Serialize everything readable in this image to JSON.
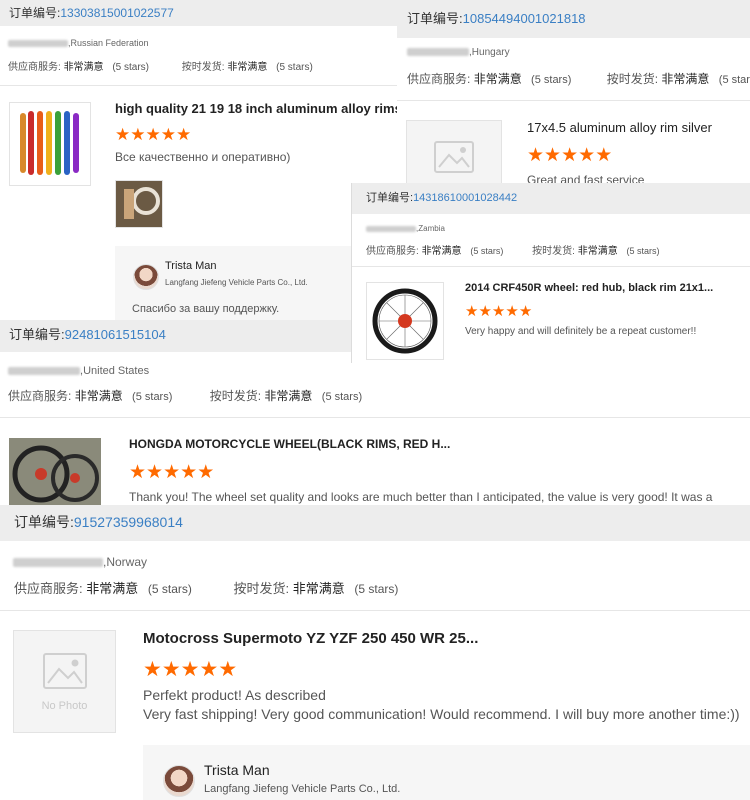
{
  "labels": {
    "order_no": "订单编号:",
    "supplier_service": "供应商服务:",
    "on_time_shipping": "按时发货:",
    "very_satisfied": "非常满意",
    "stars5": "(5 stars)",
    "no_photo": "No Photo"
  },
  "colors": {
    "accent_star": "#ff6a00",
    "order_link": "#3a7fc4",
    "header_bg": "#ededed"
  },
  "orders": [
    {
      "order_number": "13303815001022577",
      "country": "Russian Federation",
      "product_title": "high quality 21 19 18 inch aluminum alloy rims...",
      "rating": 5,
      "comment": "Все качественно и оперативно)",
      "reply": {
        "name": "Trista Man",
        "company": "Langfang Jiefeng Vehicle Parts Co., Ltd.",
        "text": "Спасибо за вашу поддержку."
      }
    },
    {
      "order_number": "10854494001021818",
      "country": "Hungary",
      "product_title": "17x4.5 aluminum alloy rim silver",
      "rating": 5,
      "comment": "Great and fast service"
    },
    {
      "order_number": "14318610001028442",
      "country": "Zambia",
      "product_title": "2014 CRF450R wheel: red hub, black rim 21x1...",
      "rating": 5,
      "comment": "Very happy and will definitely be a repeat customer!!"
    },
    {
      "order_number": "92481061515104",
      "country": "United States",
      "product_title": "HONGDA MOTORCYCLE WHEEL(BLACK RIMS, RED H...",
      "rating": 5,
      "comment": "Thank you! The wheel set quality and looks are much better than I anticipated, the value is very good! It was a"
    },
    {
      "order_number": "91527359968014",
      "country": "Norway",
      "product_title": "Motocross Supermoto YZ YZF 250 450 WR 25...",
      "rating": 5,
      "comment_line1": "Perfekt product! As described",
      "comment_line2": "Very fast shipping! Very good communication! Would recommend. I will buy more another time:))",
      "reply": {
        "name": "Trista Man",
        "company": "Langfang Jiefeng Vehicle Parts Co., Ltd."
      }
    }
  ]
}
